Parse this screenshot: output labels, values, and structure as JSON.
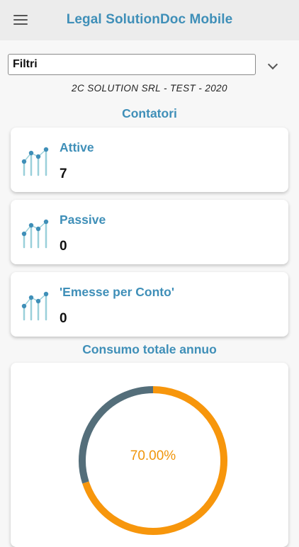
{
  "header": {
    "title": "Legal SolutionDoc Mobile",
    "menu_icon": "hamburger-menu-icon"
  },
  "filter": {
    "value": "Filtri",
    "dropdown_icon": "chevron-down-icon"
  },
  "company_info": "2C SOLUTION SRL - TEST - 2020",
  "counters_section": {
    "title": "Contatori",
    "items": [
      {
        "label": "Attive",
        "value": "7",
        "icon": "chart-icon"
      },
      {
        "label": "Passive",
        "value": "0",
        "icon": "chart-icon"
      },
      {
        "label": "'Emesse per Conto'",
        "value": "0",
        "icon": "chart-icon"
      }
    ]
  },
  "consumption_section": {
    "title": "Consumo totale annuo",
    "percent_label": "70.00%"
  },
  "chart_data": {
    "type": "pie",
    "values": [
      70,
      30
    ],
    "colors": [
      "#f7960c",
      "#546e7a"
    ]
  },
  "colors": {
    "accent": "#3f8fb8",
    "appbar": "#ececec",
    "donut_primary": "#f7960c",
    "donut_secondary": "#546e7a"
  }
}
